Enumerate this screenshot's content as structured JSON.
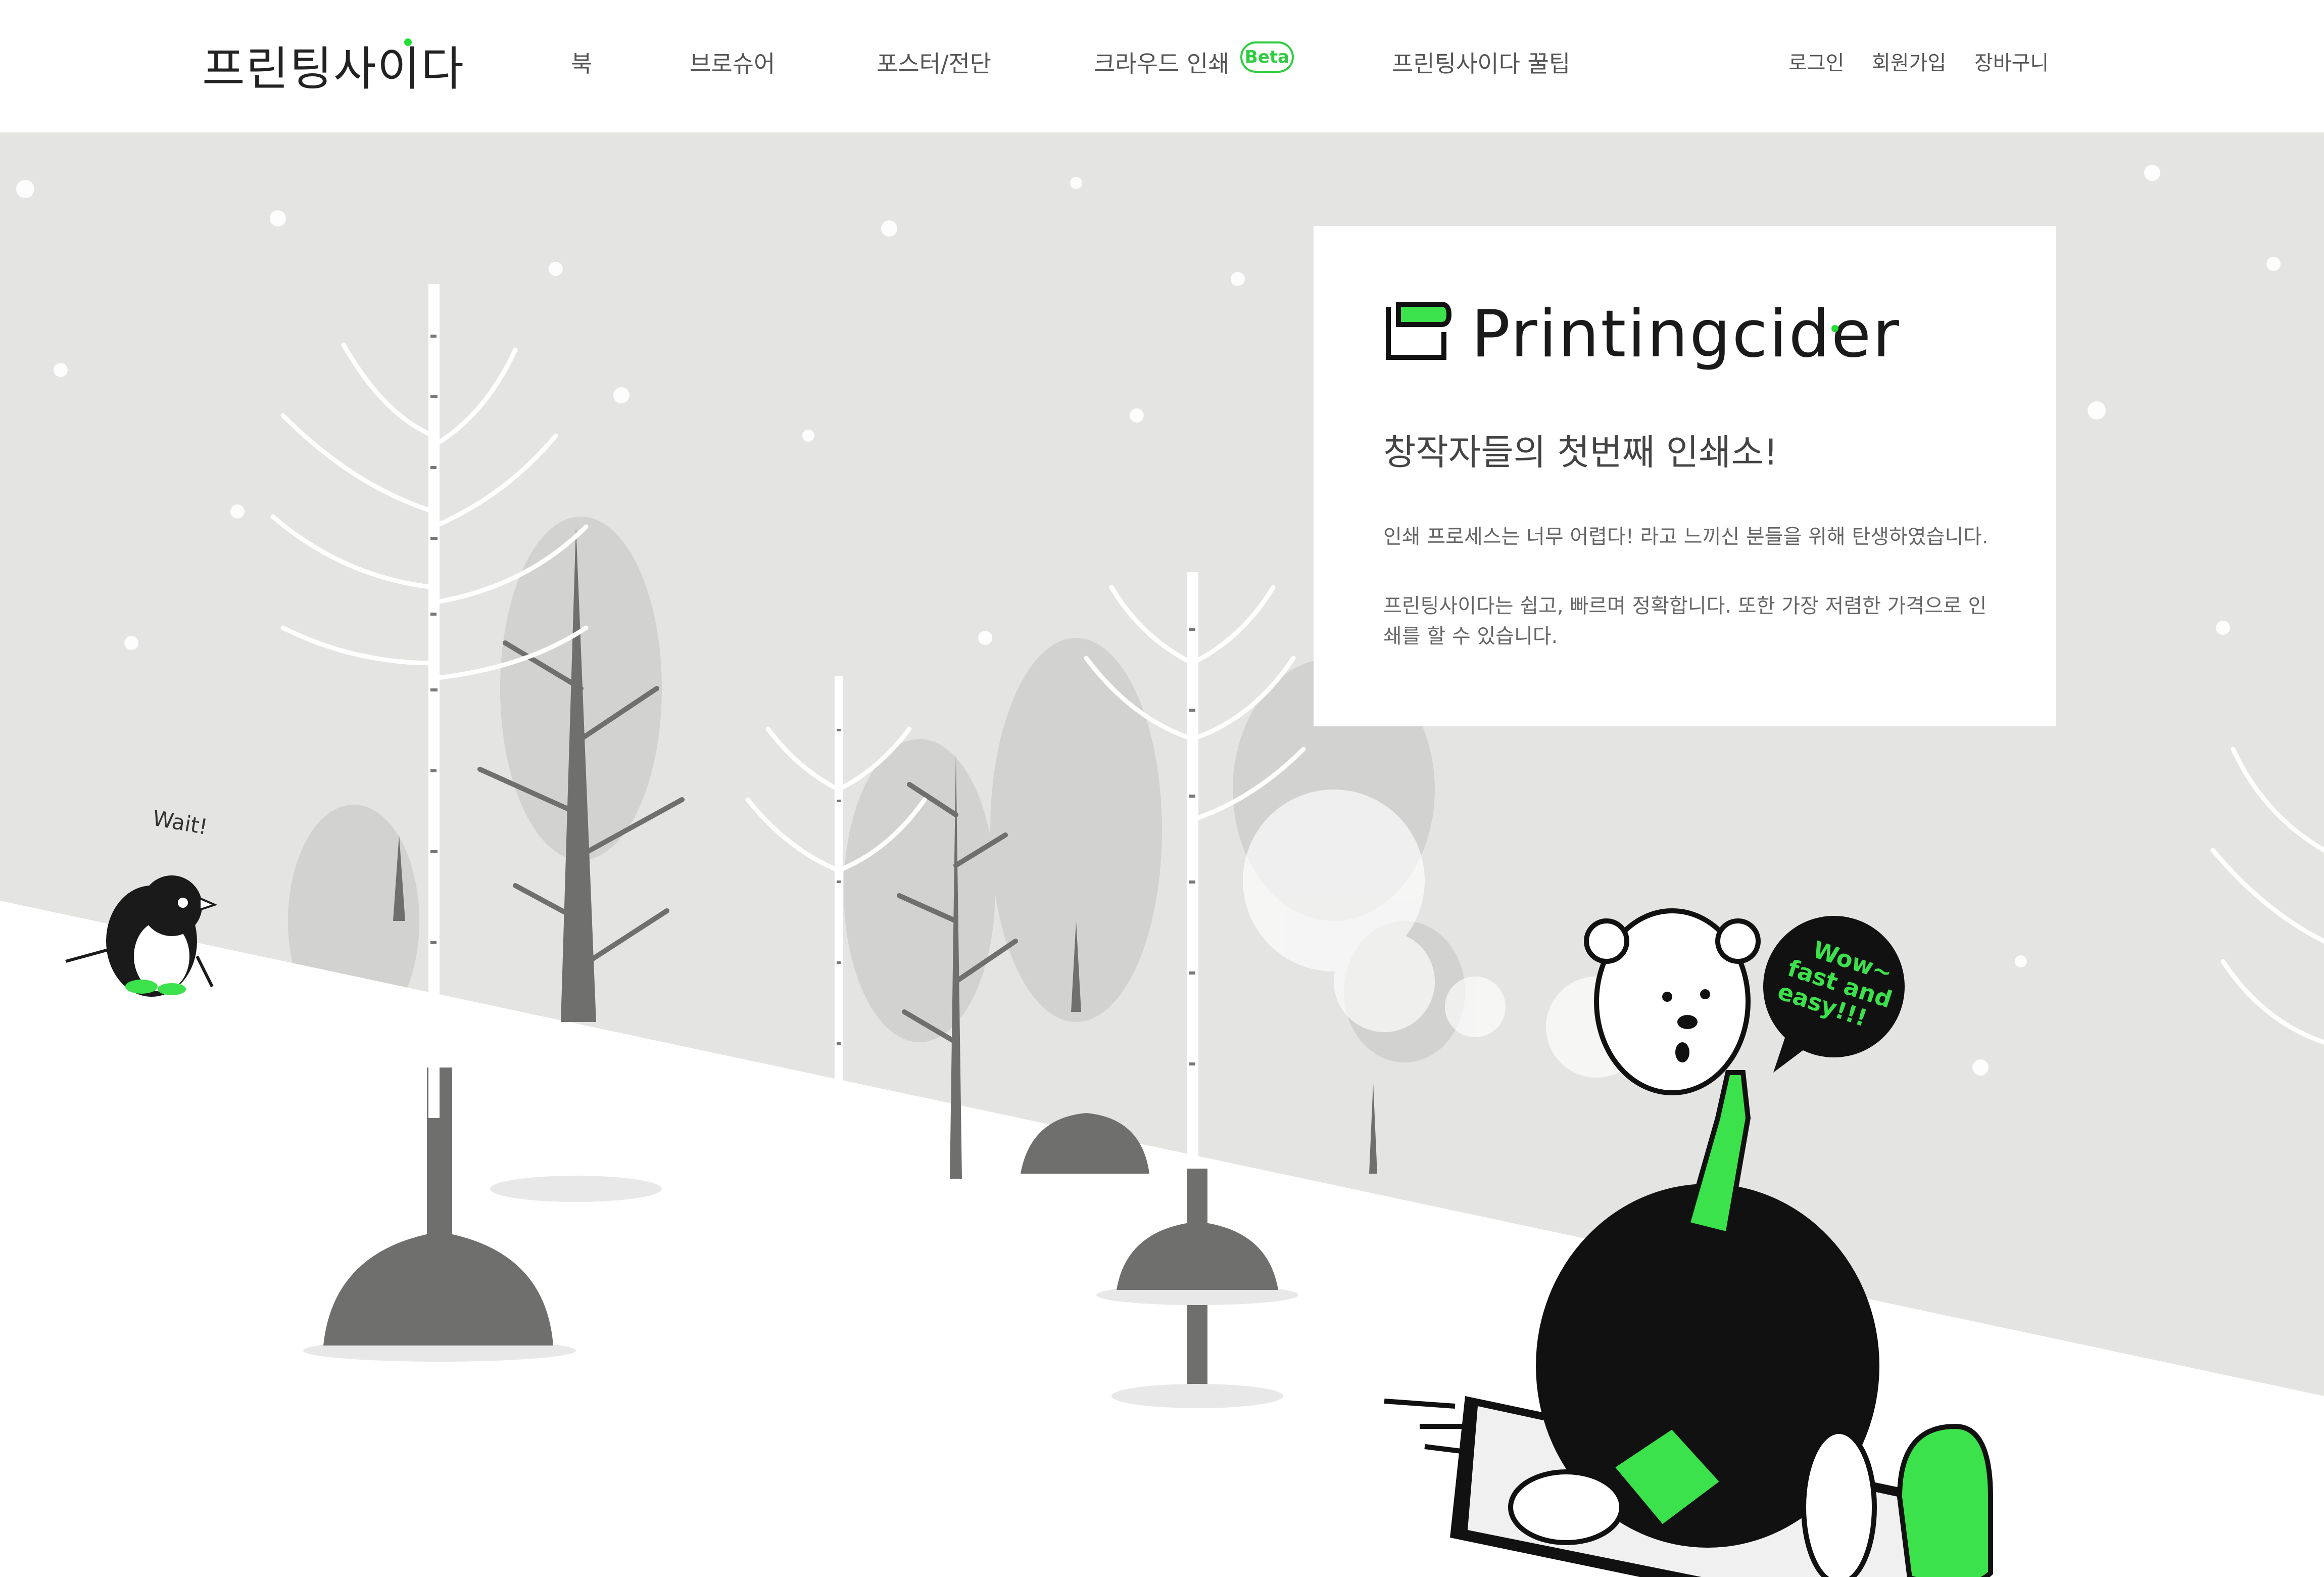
{
  "nav": {
    "logo": "프린팅사이다",
    "items": [
      {
        "label": "북"
      },
      {
        "label": "브로슈어"
      },
      {
        "label": "포스터/전단"
      },
      {
        "label": "크라우드 인쇄"
      },
      {
        "label": "프린팅사이다 꿀팁"
      }
    ],
    "beta_badge": "Beta",
    "util": {
      "login": "로그인",
      "signup": "회원가입",
      "cart": "장바구니"
    }
  },
  "hero": {
    "penguin_speech": "Wait!",
    "bear_speech_lines": [
      "Wow~",
      "fast and",
      "easy!!!"
    ]
  },
  "card": {
    "brand_name": "Printingcider",
    "headline": "창작자들의 첫번째 인쇄소!",
    "paragraph1": "인쇄 프로세스는 너무 어렵다! 라고 느끼신 분들을 위해 탄생하였습니다.",
    "paragraph2": "프린팅사이다는 쉽고, 빠르며 정확합니다. 또한 가장 저렴한 가격으로 인쇄를 할 수 있습니다."
  },
  "colors": {
    "accent": "#22dd33",
    "sky": "#e4e4e3",
    "snow": "#ffffff",
    "tree": "#6f6f6d"
  }
}
